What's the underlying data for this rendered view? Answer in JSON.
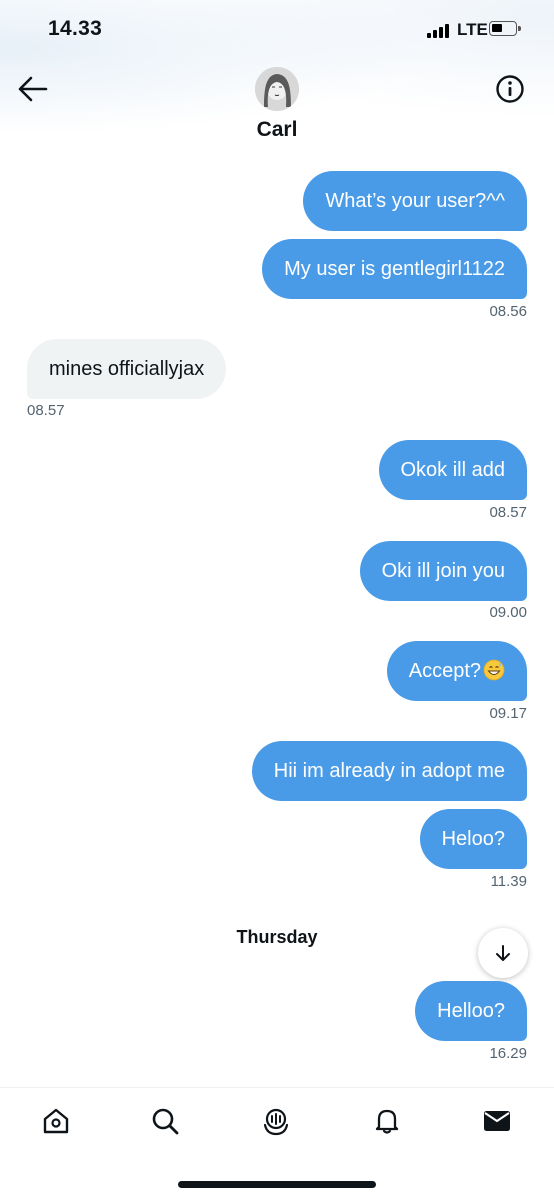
{
  "status_bar": {
    "time": "14.33",
    "network": "LTE"
  },
  "header": {
    "contact_name": "Carl"
  },
  "messages": [
    {
      "text": "What’s your user?^^",
      "side": "sent"
    },
    {
      "text": "My user is gentlegirl1122",
      "side": "sent",
      "time": "08.56"
    },
    {
      "text": "mines officiallyjax",
      "side": "received",
      "time": "08.57"
    },
    {
      "text": "Okok ill add",
      "side": "sent",
      "time": "08.57"
    },
    {
      "text": "Oki ill join you",
      "side": "sent",
      "time": "09.00"
    },
    {
      "text": "Accept?",
      "emoji": "grinning-sweat-emoji",
      "side": "sent",
      "time": "09.17"
    },
    {
      "text": "Hii im already in adopt me",
      "side": "sent"
    },
    {
      "text": "Heloo?",
      "side": "sent",
      "time": "11.39"
    },
    {
      "text": "Helloo?",
      "side": "sent",
      "time": "16.29"
    }
  ],
  "day_separator": "Thursday",
  "bottom_nav": [
    "home-icon",
    "search-icon",
    "spaces-icon",
    "bell-icon",
    "messages-icon"
  ],
  "colors": {
    "sent_bubble": "#4a9be7",
    "received_bubble": "#eff3f4",
    "timestamp": "#536471"
  }
}
